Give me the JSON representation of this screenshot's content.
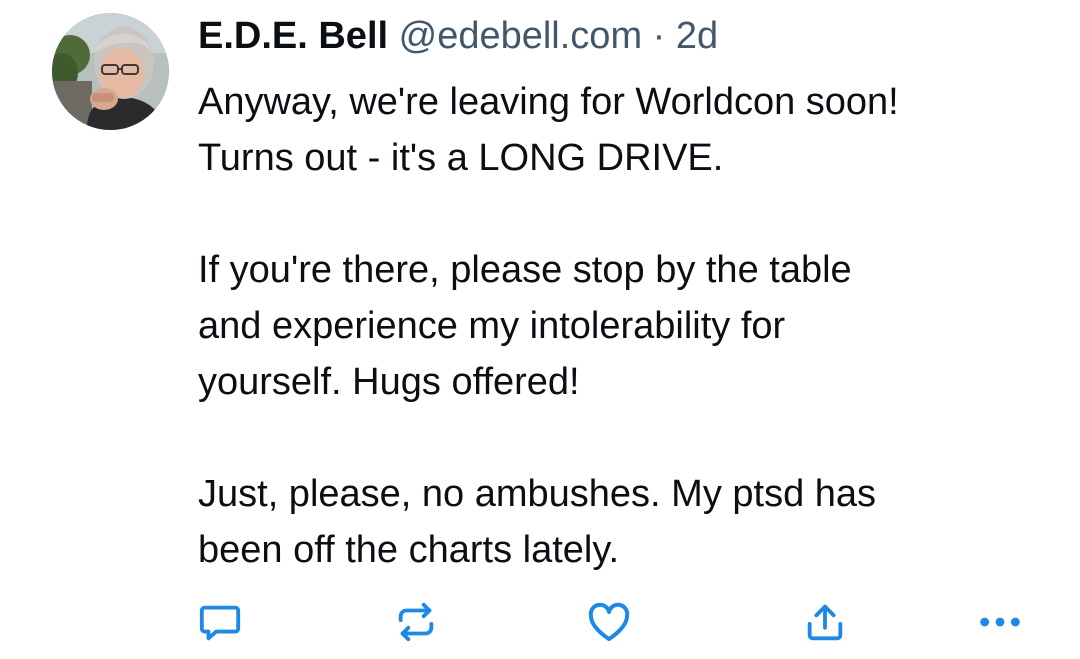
{
  "post": {
    "author": {
      "display_name": "E.D.E. Bell",
      "handle": "@edebell.com",
      "separator": "·",
      "timestamp": "2d"
    },
    "paragraphs": [
      [
        "Anyway, we're leaving for Worldcon soon!",
        "Turns out - it's a LONG DRIVE."
      ],
      [
        "If you're there, please stop by the table",
        "and experience my intolerability for",
        "yourself. Hugs offered!"
      ],
      [
        "Just, please, no ambushes. My ptsd has",
        "been off the charts lately."
      ]
    ],
    "actions": {
      "reply_icon": "reply-icon",
      "repost_icon": "repost-icon",
      "like_icon": "heart-icon",
      "share_icon": "share-icon",
      "more_icon": "more-icon"
    },
    "colors": {
      "text": "#0b0f14",
      "muted": "#42576c",
      "action_icon": "#1e88e5"
    }
  }
}
